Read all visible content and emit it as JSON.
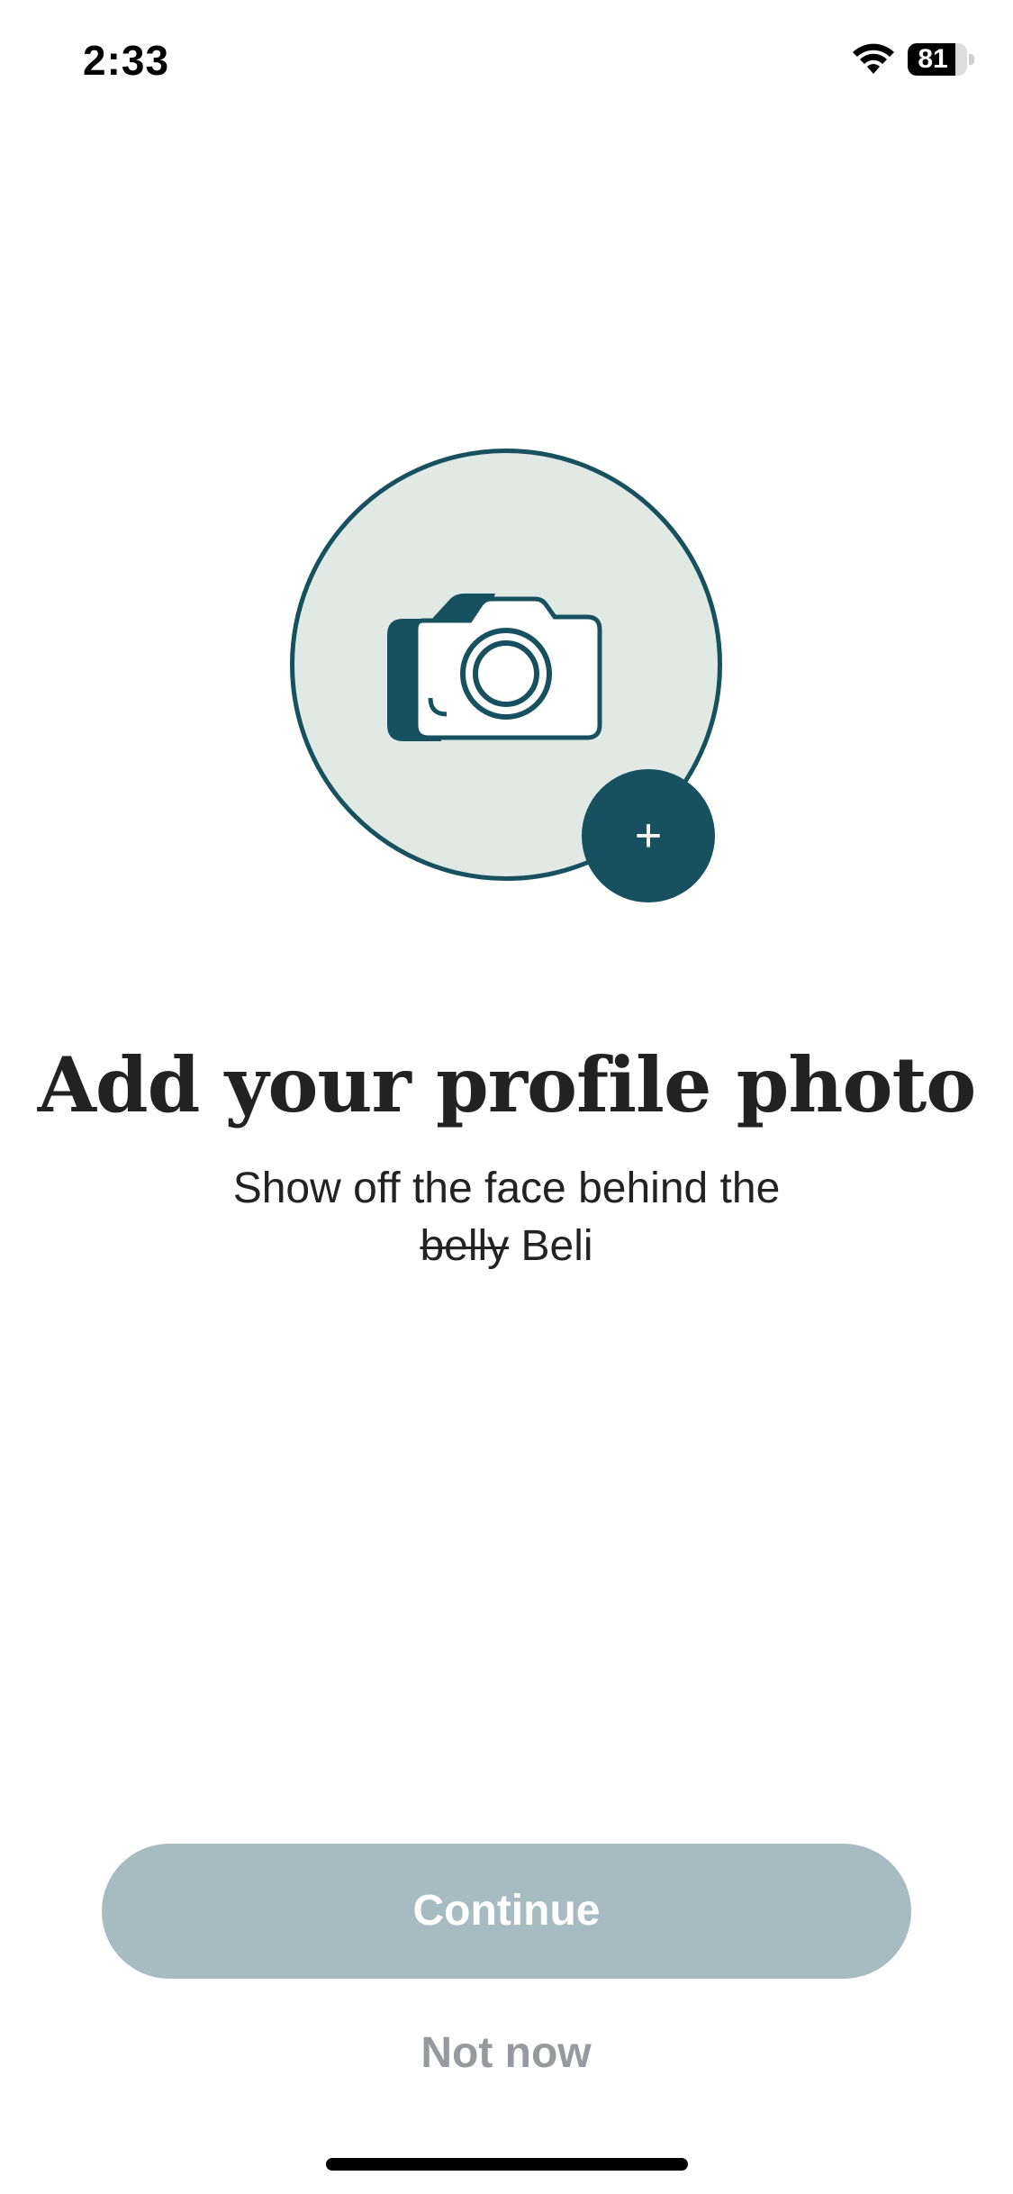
{
  "status_bar": {
    "time": "2:33",
    "battery_level": "81",
    "battery_fraction": 0.81,
    "icons": [
      "wifi-icon",
      "battery-icon"
    ]
  },
  "avatar": {
    "icon": "camera-icon",
    "add_button_icon": "plus-icon",
    "add_button_label": "+"
  },
  "content": {
    "title": "Add your profile photo",
    "subtitle_line1": "Show off the face behind the",
    "subtitle_struck": "belly",
    "subtitle_rest": "Beli"
  },
  "actions": {
    "continue_label": "Continue",
    "not_now_label": "Not now"
  },
  "colors": {
    "accent": "#17505e",
    "avatar_bg": "#e1e9e5",
    "continue_disabled_bg": "#a7bcc2",
    "secondary_text": "#97999c"
  }
}
